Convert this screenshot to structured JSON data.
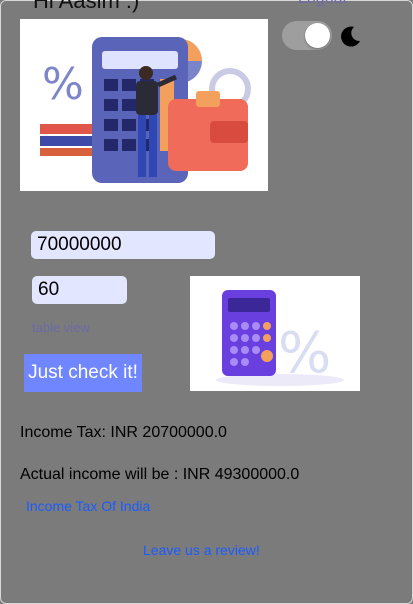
{
  "header": {
    "greeting": "Hi Aasim :)",
    "logout_label": "Logout"
  },
  "theme_toggle": {
    "state": "on",
    "icon": "moon-icon"
  },
  "images": {
    "hero": "calculator-illustration",
    "tax_calc": "calculator-percent-illustration"
  },
  "form": {
    "income_value": "70000000",
    "tax_rate_value": "60",
    "table_view_label": "table view",
    "check_button_label": "Just check it!"
  },
  "results": {
    "income_tax": "Income Tax: INR 20700000.0",
    "actual_income": "Actual income will be : INR 49300000.0"
  },
  "links": {
    "income_tax_india": "Income Tax Of India",
    "review": "Leave us a review!"
  },
  "colors": {
    "background": "#7b7b7b",
    "accent_button": "#6f86ff",
    "input_bg": "#e3e6ff",
    "link": "#1a5cff"
  }
}
